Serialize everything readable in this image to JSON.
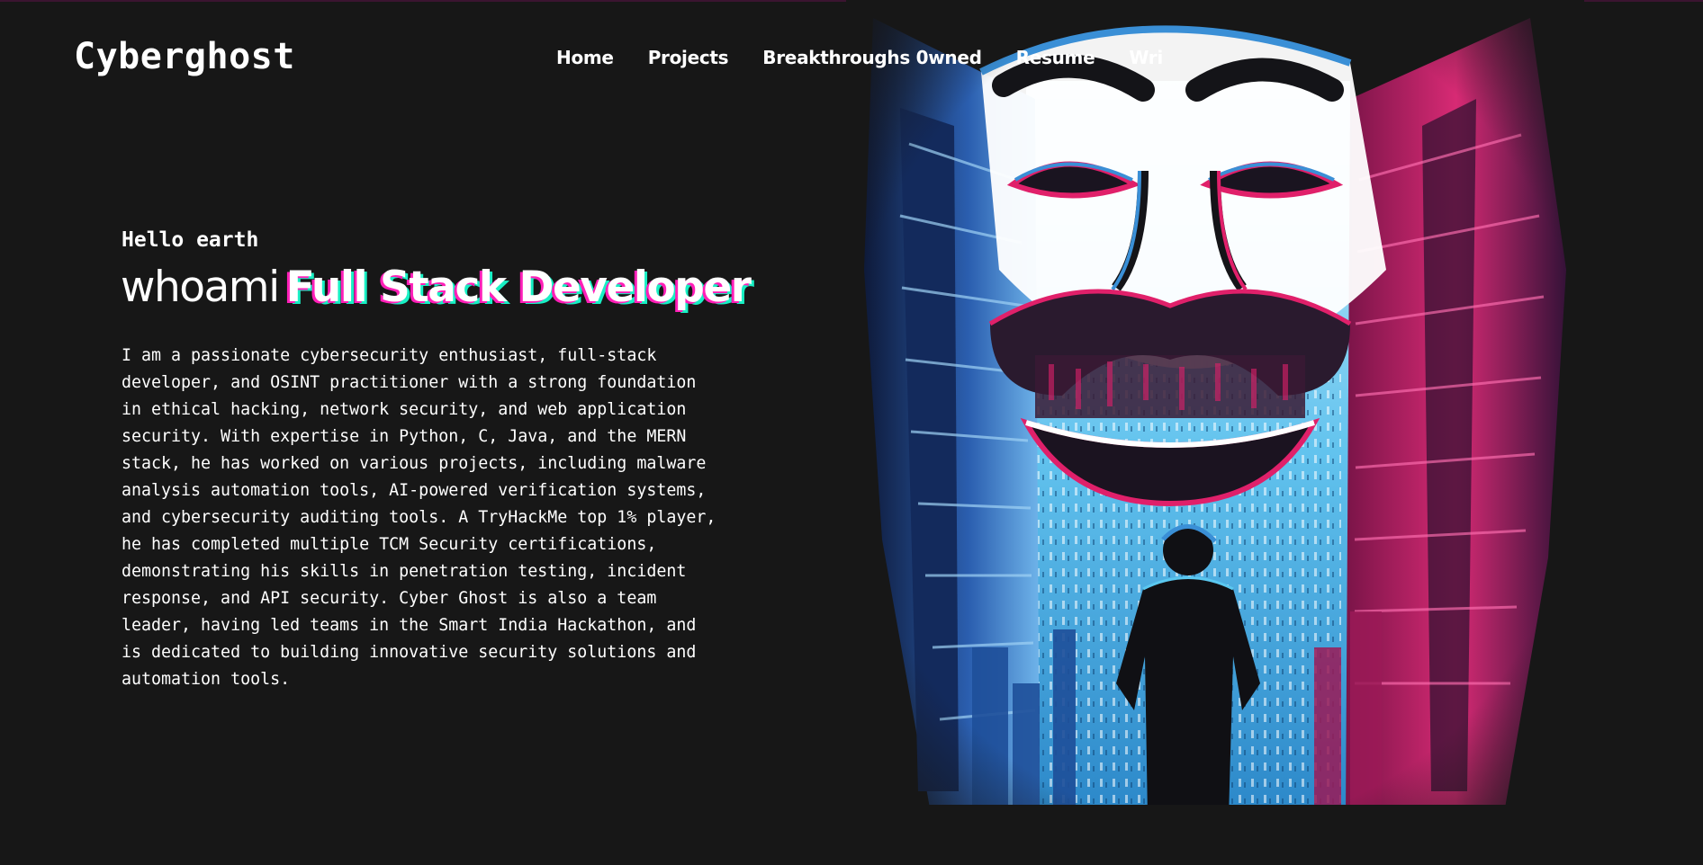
{
  "header": {
    "brand": "Cyberghost",
    "nav": [
      {
        "label": "Home"
      },
      {
        "label": "Projects"
      },
      {
        "label": "Breakthroughs 0wned"
      },
      {
        "label": "Resume"
      },
      {
        "label": "Wri"
      }
    ]
  },
  "hero": {
    "greeting": "Hello earth",
    "headline_prefix": "whoami",
    "headline_role": "Full Stack Developer",
    "bio": "I am a passionate cybersecurity enthusiast, full-stack developer, and OSINT practitioner with a strong foundation in ethical hacking, network security, and web application security. With expertise in Python, C, Java, and the MERN stack, he has worked on various projects, including malware analysis automation tools, AI-powered verification systems, and cybersecurity auditing tools. A TryHackMe top 1% player, he has completed multiple TCM Security certifications, demonstrating his skills in penetration testing, incident response, and API security. Cyber Ghost is also a team leader, having led teams in the Smart India Hackathon, and is dedicated to building innovative security solutions and automation tools."
  },
  "colors": {
    "background": "#171717",
    "accent_pink": "#ff1fb8",
    "accent_teal": "#18f0c4",
    "art_blue": "#3a8fd6",
    "art_cyan": "#5ac8f0",
    "art_magenta": "#e0206a"
  }
}
